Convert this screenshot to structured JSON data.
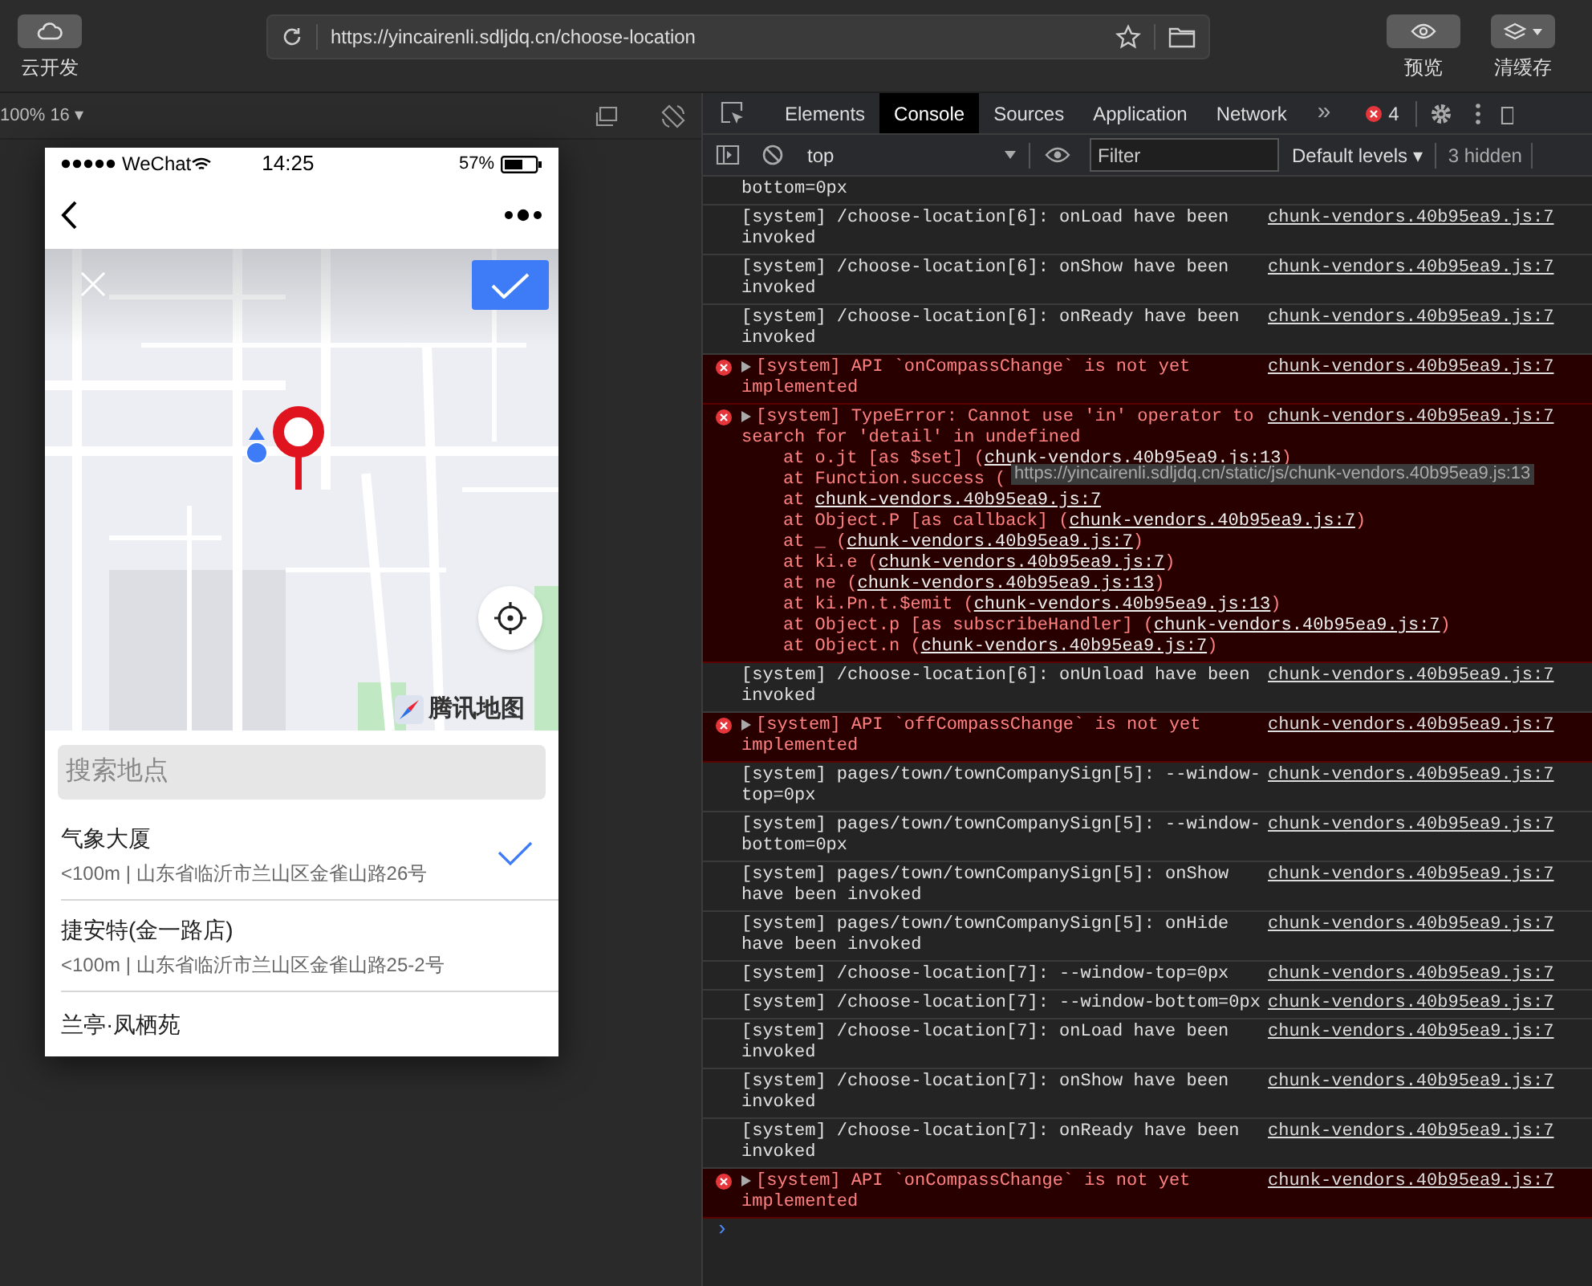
{
  "toolbar": {
    "cloud_label": "云开发",
    "url": "https://yincairenli.sdljdq.cn/choose-location",
    "preview_label": "预览",
    "cache_label": "清缓存"
  },
  "simulator": {
    "zoom": "100% 16 ▾",
    "phone": {
      "carrier": "WeChat",
      "time": "14:25",
      "battery": "57%",
      "map": {
        "logo": "腾讯地图"
      },
      "search": {
        "placeholder": "搜索地点"
      },
      "places": [
        {
          "name": "气象大厦",
          "detail": "<100m | 山东省临沂市兰山区金雀山路26号",
          "selected": true
        },
        {
          "name": "捷安特(金一路店)",
          "detail": "<100m | 山东省临沂市兰山区金雀山路25-2号",
          "selected": false
        },
        {
          "name": "兰亭·凤栖苑",
          "selected": false
        }
      ]
    }
  },
  "devtools": {
    "tabs": [
      {
        "label": "Elements",
        "selected": false
      },
      {
        "label": "Console",
        "selected": true
      },
      {
        "label": "Sources",
        "selected": false
      },
      {
        "label": "Application",
        "selected": false
      },
      {
        "label": "Network",
        "selected": false
      }
    ],
    "more": "»",
    "error_count": "4",
    "context": "top",
    "filter": {
      "placeholder": "Filter"
    },
    "levels": "Default levels ▾",
    "hidden": "3 hidden",
    "tooltip": "https://yincairenli.sdljdq.cn/static/js/chunk-vendors.40b95ea9.js:13",
    "logs": [
      {
        "kind": "info",
        "message": "bottom=0px"
      },
      {
        "kind": "info",
        "message": "[system] /choose-location[6]: onLoad have been invoked",
        "link": "chunk-vendors.40b95ea9.js:7"
      },
      {
        "kind": "info",
        "message": "[system] /choose-location[6]: onShow have been invoked",
        "link": "chunk-vendors.40b95ea9.js:7"
      },
      {
        "kind": "info",
        "message": "[system] /choose-location[6]: onReady have been invoked",
        "link": "chunk-vendors.40b95ea9.js:7"
      },
      {
        "kind": "error",
        "message": "[system] API `onCompassChange` is not yet implemented",
        "link": "chunk-vendors.40b95ea9.js:7"
      },
      {
        "kind": "error",
        "message": "[system] TypeError: Cannot use 'in' operator to search for 'detail' in undefined",
        "link": "chunk-vendors.40b95ea9.js:7",
        "stack": [
          {
            "text": "at o.jt [as $set] (",
            "link": "chunk-vendors.40b95ea9.js:13",
            "after": ")"
          },
          {
            "text": "at Function.success ("
          },
          {
            "text": "at ",
            "link": "chunk-vendors.40b95ea9.js:7"
          },
          {
            "text": "at Object.P [as callback] (",
            "link": "chunk-vendors.40b95ea9.js:7",
            "after": ")"
          },
          {
            "text": "at _ (",
            "link": "chunk-vendors.40b95ea9.js:7",
            "after": ")"
          },
          {
            "text": "at ki.e (",
            "link": "chunk-vendors.40b95ea9.js:7",
            "after": ")"
          },
          {
            "text": "at ne (",
            "link": "chunk-vendors.40b95ea9.js:13",
            "after": ")"
          },
          {
            "text": "at ki.Pn.t.$emit (",
            "link": "chunk-vendors.40b95ea9.js:13",
            "after": ")"
          },
          {
            "text": "at Object.p [as subscribeHandler] (",
            "link": "chunk-vendors.40b95ea9.js:7",
            "after": ")"
          },
          {
            "text": "at Object.n (",
            "link": "chunk-vendors.40b95ea9.js:7",
            "after": ")"
          }
        ]
      },
      {
        "kind": "info",
        "message": "[system] /choose-location[6]: onUnload have been invoked",
        "link": "chunk-vendors.40b95ea9.js:7"
      },
      {
        "kind": "error",
        "message": "[system] API `offCompassChange` is not yet implemented",
        "link": "chunk-vendors.40b95ea9.js:7"
      },
      {
        "kind": "info",
        "message": "[system] pages/town/townCompanySign[5]: --window-top=0px",
        "link": "chunk-vendors.40b95ea9.js:7"
      },
      {
        "kind": "info",
        "message": "[system] pages/town/townCompanySign[5]: --window-bottom=0px",
        "link": "chunk-vendors.40b95ea9.js:7"
      },
      {
        "kind": "info",
        "message": "[system] pages/town/townCompanySign[5]: onShow have been invoked",
        "link": "chunk-vendors.40b95ea9.js:7"
      },
      {
        "kind": "info",
        "message": "[system] pages/town/townCompanySign[5]: onHide have been invoked",
        "link": "chunk-vendors.40b95ea9.js:7"
      },
      {
        "kind": "info",
        "message": "[system] /choose-location[7]: --window-top=0px",
        "link": "chunk-vendors.40b95ea9.js:7"
      },
      {
        "kind": "info",
        "message": "[system] /choose-location[7]: --window-bottom=0px",
        "link": "chunk-vendors.40b95ea9.js:7"
      },
      {
        "kind": "info",
        "message": "[system] /choose-location[7]: onLoad have been invoked",
        "link": "chunk-vendors.40b95ea9.js:7"
      },
      {
        "kind": "info",
        "message": "[system] /choose-location[7]: onShow have been invoked",
        "link": "chunk-vendors.40b95ea9.js:7"
      },
      {
        "kind": "info",
        "message": "[system] /choose-location[7]: onReady have been invoked",
        "link": "chunk-vendors.40b95ea9.js:7"
      },
      {
        "kind": "error",
        "message": "[system] API `onCompassChange` is not yet implemented",
        "link": "chunk-vendors.40b95ea9.js:7"
      }
    ],
    "prompt": "›"
  }
}
